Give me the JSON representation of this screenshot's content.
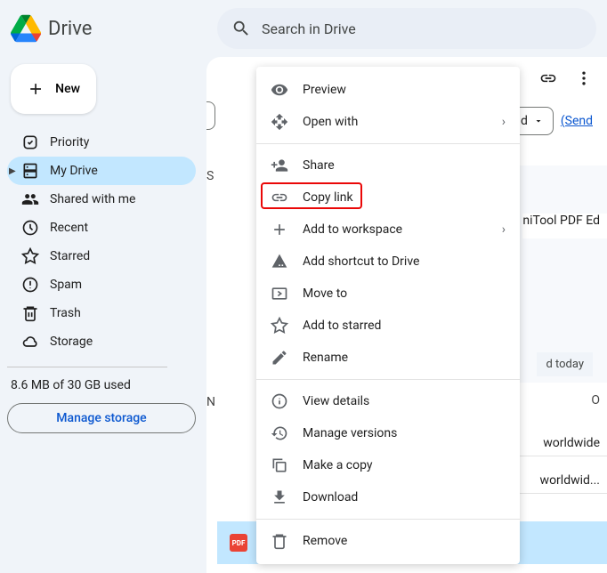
{
  "header": {
    "app_name": "Drive",
    "search_placeholder": "Search in Drive"
  },
  "sidebar": {
    "new_label": "New",
    "items": [
      {
        "label": "Priority"
      },
      {
        "label": "My Drive"
      },
      {
        "label": "Shared with me"
      },
      {
        "label": "Recent"
      },
      {
        "label": "Starred"
      },
      {
        "label": "Spam"
      },
      {
        "label": "Trash"
      },
      {
        "label": "Storage"
      }
    ],
    "storage_used": "8.6 MB of 30 GB used",
    "manage_label": "Manage storage"
  },
  "main": {
    "section_s": "S",
    "section_n": "N",
    "section_o": "O",
    "chip_label": "d",
    "send_label": "(Send",
    "file_preview": "niTool PDF Ed",
    "mod_today": "d today",
    "files": [
      {
        "name": "worldwide"
      },
      {
        "name": "worldwid..."
      }
    ],
    "selected_file": "MiniTool PDF Editor.pdf",
    "pdf_badge": "PDF"
  },
  "context_menu": {
    "preview": "Preview",
    "open_with": "Open with",
    "share": "Share",
    "copy_link": "Copy link",
    "add_workspace": "Add to workspace",
    "add_shortcut": "Add shortcut to Drive",
    "move_to": "Move to",
    "add_starred": "Add to starred",
    "rename": "Rename",
    "view_details": "View details",
    "manage_versions": "Manage versions",
    "make_copy": "Make a copy",
    "download": "Download",
    "remove": "Remove"
  }
}
